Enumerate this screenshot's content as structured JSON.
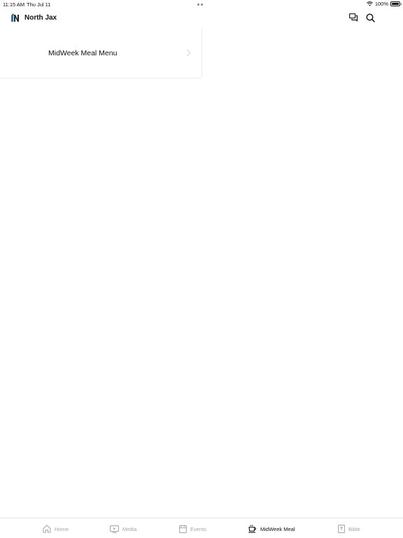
{
  "status_bar": {
    "time": "11:15 AM",
    "date": "Thu Jul 11",
    "battery": "100%",
    "icons": [
      "wifi-icon",
      "battery-icon"
    ]
  },
  "header": {
    "title": "North Jax",
    "logo": "north-jax-logo",
    "actions": [
      "chat-icon",
      "search-icon"
    ]
  },
  "menu": {
    "items": [
      {
        "label": "MidWeek Meal Menu",
        "icon": "chevron-right-icon"
      }
    ]
  },
  "tabs": [
    {
      "label": "Home",
      "icon": "home-icon",
      "active": false
    },
    {
      "label": "Media",
      "icon": "tv-icon",
      "active": false
    },
    {
      "label": "Events",
      "icon": "calendar-icon",
      "active": false
    },
    {
      "label": "MidWeek Meal",
      "icon": "coffee-icon",
      "active": true
    },
    {
      "label": "Bible",
      "icon": "bible-icon",
      "active": false
    }
  ],
  "colors": {
    "active_tab": "#111111",
    "inactive_tab": "#a8a8a8",
    "logo_blue": "#3f6f8f",
    "logo_dark": "#1c2a36"
  }
}
